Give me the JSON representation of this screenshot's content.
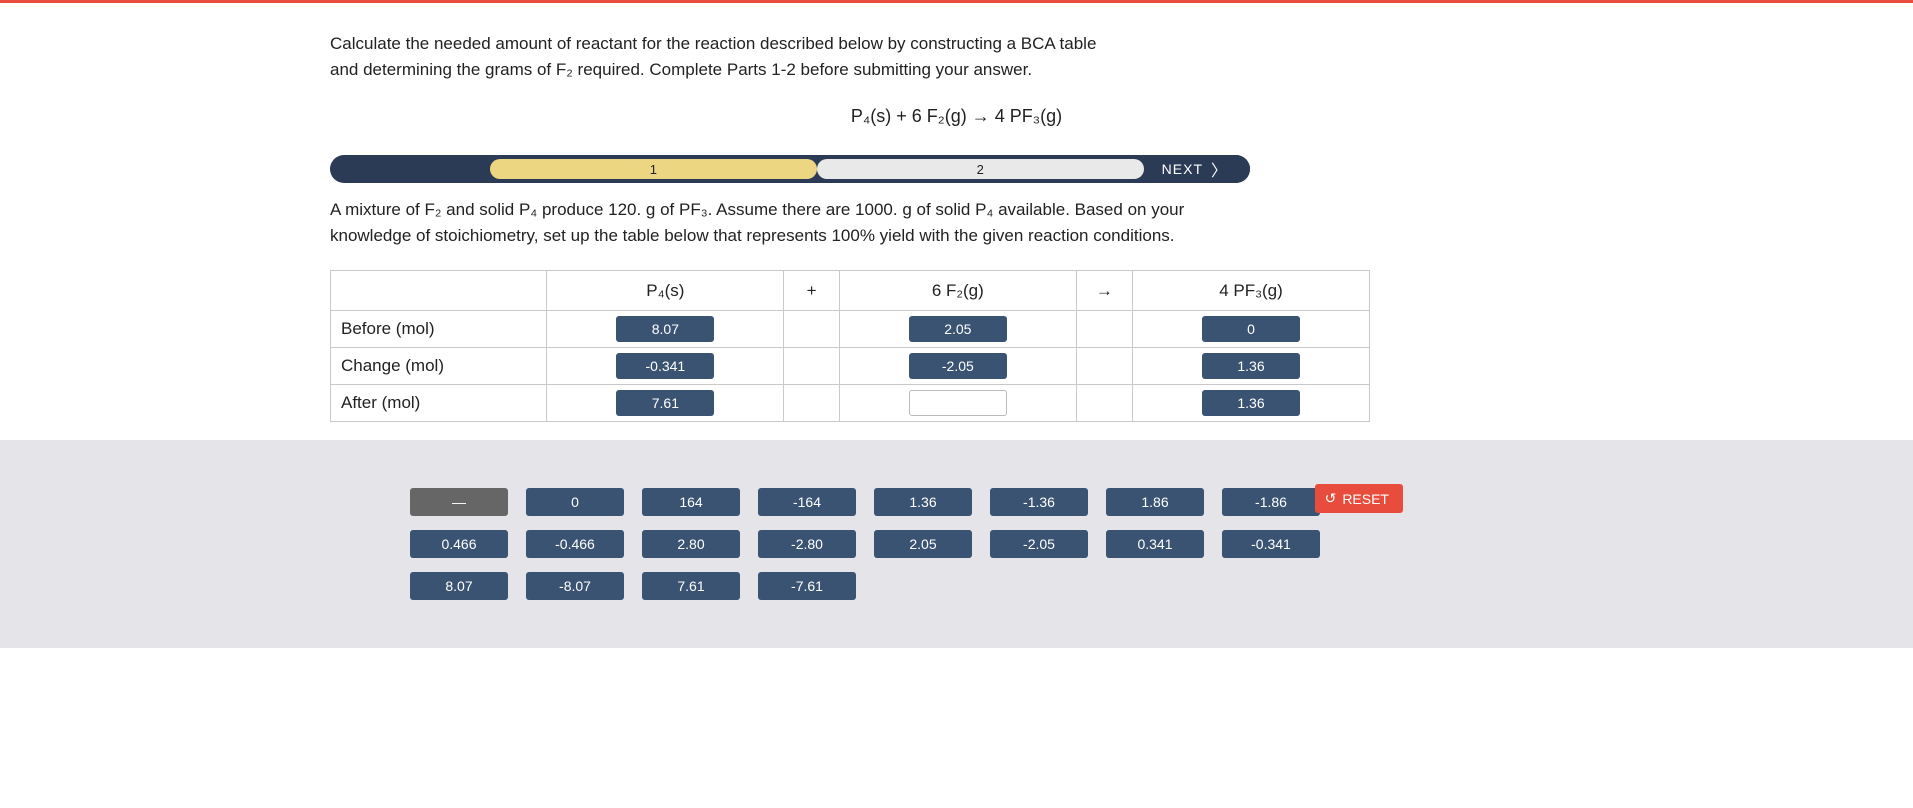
{
  "instructions": "Calculate the needed amount of reactant for the reaction described below by constructing a BCA table and determining the grams of F₂ required. Complete Parts 1-2 before submitting your answer.",
  "equation": "P₄(s) + 6 F₂(g) → 4 PF₃(g)",
  "steps": {
    "s1": "1",
    "s2": "2",
    "next": "NEXT"
  },
  "part_question": "A mixture of F₂ and solid P₄ produce 120. g of PF₃. Assume there are 1000. g of solid P₄ available. Based on your knowledge of stoichiometry, set up the table below that represents 100% yield with the given reaction conditions.",
  "table": {
    "headers": {
      "c1": "P₄(s)",
      "plus": "+",
      "c2": "6 F₂(g)",
      "arrow": "→",
      "c3": "4 PF₃(g)"
    },
    "rows": {
      "before": {
        "label": "Before (mol)",
        "c1": "8.07",
        "c2": "2.05",
        "c3": "0"
      },
      "change": {
        "label": "Change (mol)",
        "c1": "-0.341",
        "c2": "-2.05",
        "c3": "1.36"
      },
      "after": {
        "label": "After (mol)",
        "c1": "7.61",
        "c2": "",
        "c3": "1.36"
      }
    }
  },
  "reset": "RESET",
  "options": {
    "row1": [
      "—",
      "0",
      "164",
      "-164",
      "1.36",
      "-1.36",
      "1.86",
      "-1.86"
    ],
    "row2": [
      "0.466",
      "-0.466",
      "2.80",
      "-2.80",
      "2.05",
      "-2.05",
      "0.341",
      "-0.341"
    ],
    "row3": [
      "8.07",
      "-8.07",
      "7.61",
      "-7.61"
    ]
  }
}
